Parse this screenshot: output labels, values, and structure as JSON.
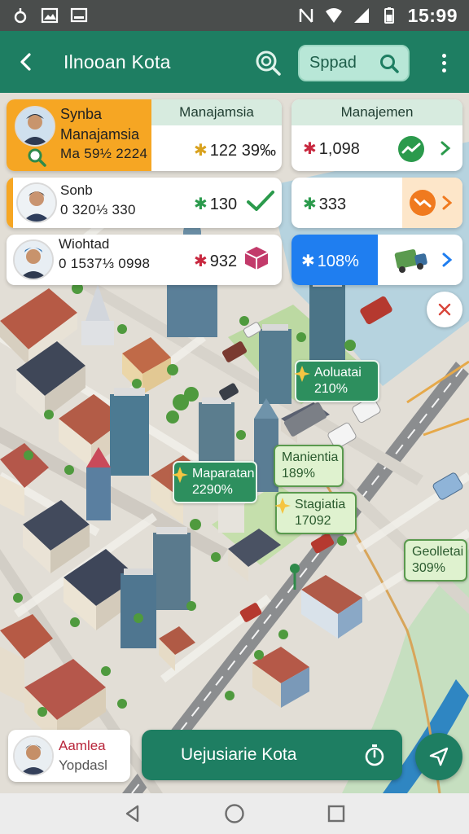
{
  "status_bar": {
    "time": "15:99"
  },
  "app_bar": {
    "title": "Ilnooan Kota",
    "search_placeholder": "Sppad"
  },
  "people": [
    {
      "name": "Synba",
      "role": "Manajamsia",
      "id": "Ma 59½ 2224",
      "stat_prefix": "✱",
      "stat": "122 39‰"
    },
    {
      "name": "Sonb",
      "id": "0 320⅓ 330",
      "stat_prefix": "✱",
      "stat": "130"
    },
    {
      "name": "Wiohtad",
      "id": "0 1537⅓ 0998",
      "stat_prefix": "✱",
      "stat": "932"
    }
  ],
  "right_panel": {
    "header": "Manajemen",
    "rows": [
      {
        "prefix": "✱",
        "value": "1,098"
      },
      {
        "prefix": "✱",
        "value": "333"
      },
      {
        "prefix": "✱",
        "value": "108%"
      }
    ]
  },
  "people_header": "Manajamsia",
  "map_labels": [
    {
      "title": "Aoluatai",
      "value": "210%"
    },
    {
      "title": "Manientia",
      "value": "189%"
    },
    {
      "title": "Maparatan",
      "value": "2290%"
    },
    {
      "title": "Stagiatia",
      "value": "17092"
    },
    {
      "title": "Geolletai",
      "value": "309%"
    }
  ],
  "profile": {
    "name": "Aamlea",
    "subtitle": "Yopdasl"
  },
  "cta": {
    "label": "Uejusiarie Kota"
  },
  "colors": {
    "primary": "#1e7e62",
    "accent": "#f6a623",
    "highlight": "#1f7ef0"
  }
}
